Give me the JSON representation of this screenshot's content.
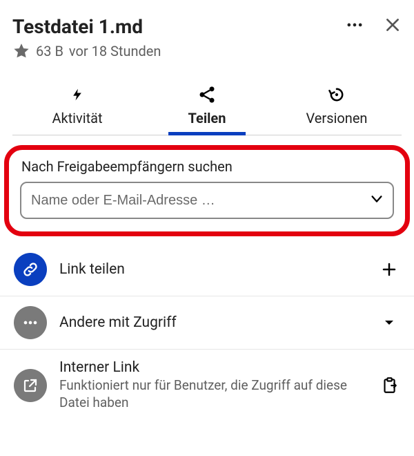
{
  "header": {
    "title": "Testdatei 1.md"
  },
  "meta": {
    "size": "63 B",
    "age": "vor 18 Stunden"
  },
  "tabs": {
    "activity": "Aktivität",
    "share": "Teilen",
    "versions": "Versionen"
  },
  "share": {
    "search_label": "Nach Freigabeempfängern suchen",
    "search_placeholder": "Name oder E-Mail-Adresse …",
    "link_share": "Link teilen",
    "others_access": "Andere mit Zugriff",
    "internal_title": "Interner Link",
    "internal_sub": "Funktioniert nur für Benutzer, die Zugriff auf diese Datei haben"
  }
}
